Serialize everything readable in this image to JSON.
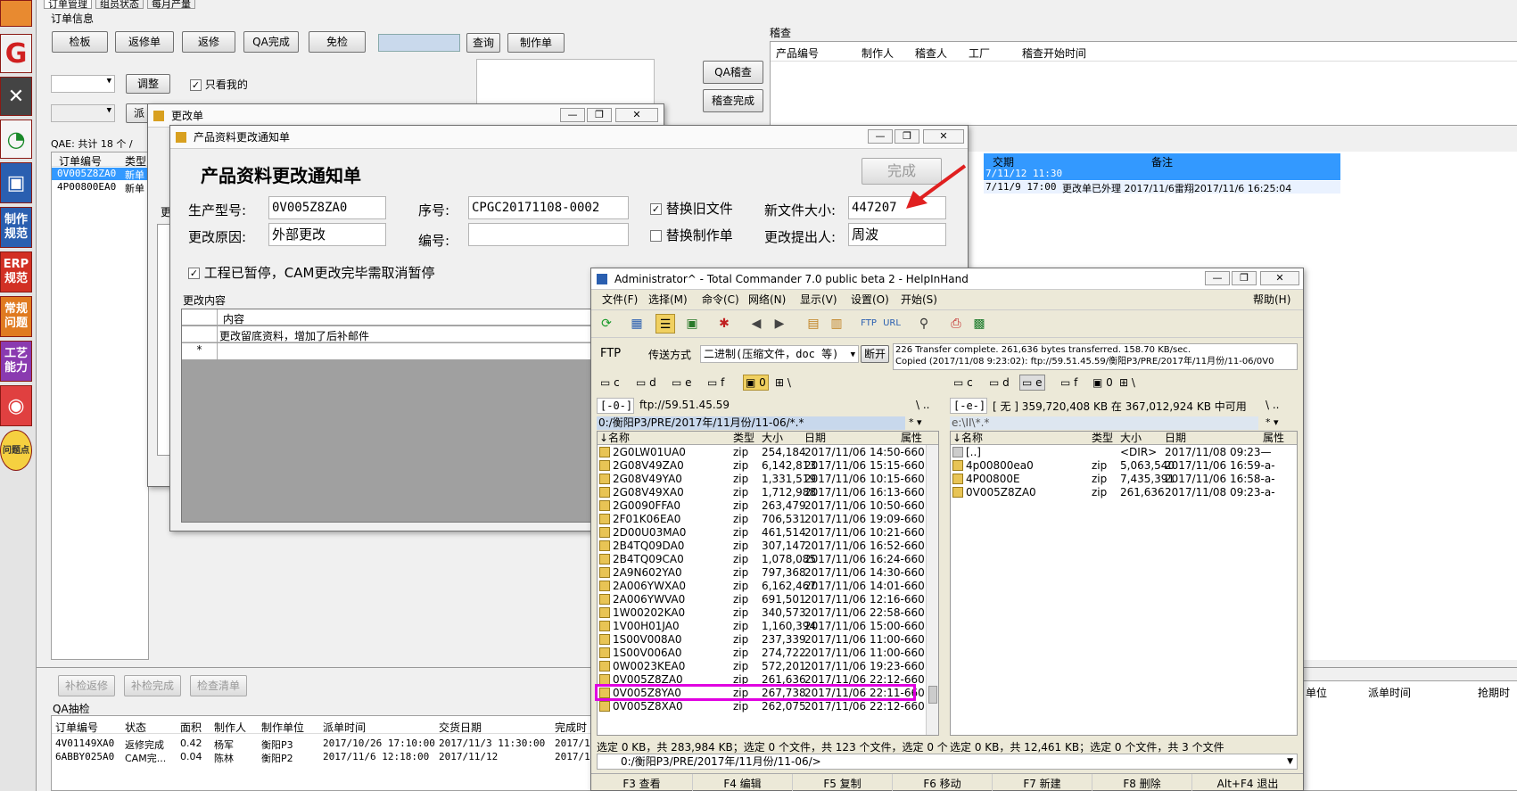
{
  "tabs": [
    "订单管理",
    "组员状态",
    "每月产量"
  ],
  "order_info_label": "订单信息",
  "top_buttons": [
    "检板",
    "返修单",
    "返修",
    "QA完成",
    "免检"
  ],
  "query_btn": "查询",
  "make_order_btn": "制作单",
  "adjust_btn": "调整",
  "only_mine_label": "只看我的",
  "dispatch_btn": "派",
  "qa_audit_btn": "QA稽查",
  "audit_done_btn": "稽查完成",
  "audit_label": "稽查",
  "audit_headers": [
    "产品编号",
    "制作人",
    "稽查人",
    "工厂",
    "稽查开始时间"
  ],
  "qae_count": "QAE: 共计 18 个 /",
  "order_headers": [
    "订单编号",
    "类型"
  ],
  "order_rows": [
    [
      "0V005Z8ZA0",
      "新单"
    ],
    [
      "4P00800EA0",
      "新单"
    ]
  ],
  "right_grid_headers": [
    "交期",
    "备注"
  ],
  "right_grid_rows": [
    [
      "7/11/12 11:30",
      ""
    ],
    [
      "7/11/9 17:00",
      "更改单已外理 2017/11/6雷翔2017/11/6 16:25:04"
    ]
  ],
  "bottom_buttons": [
    "补检返修",
    "补检完成",
    "检查清单"
  ],
  "qa_sample_label": "QA抽检",
  "qa_headers": [
    "订单编号",
    "状态",
    "面积",
    "制作人",
    "制作单位",
    "派单时间",
    "交货日期",
    "完成时"
  ],
  "qa_rows": [
    [
      "4V01149XA0",
      "返修完成",
      "0.42",
      "杨军",
      "衡阳P3",
      "2017/10/26 17:10:00",
      "2017/11/3 11:30:00",
      "2017/1"
    ],
    [
      "6ABBY025A0",
      "CAM完...",
      "0.04",
      "陈林",
      "衡阳P2",
      "2017/11/6 12:18:00",
      "2017/11/12",
      "2017/1"
    ]
  ],
  "right_bottom_headers": [
    "单位",
    "派单时间",
    "",
    "抢期时"
  ],
  "sidebar_tiles": [
    "制作\n规范",
    "ERP\n规范",
    "常规\n问题",
    "工艺\n能力",
    "问题点"
  ],
  "change_win": {
    "title": "更改单",
    "label": "更"
  },
  "notice": {
    "title": "产品资料更改通知单",
    "heading": "产品资料更改通知单",
    "done_btn": "完成",
    "model_label": "生产型号:",
    "model_value": "0V005Z8ZA0",
    "serial_label": "序号:",
    "serial_value": "CPGC20171108-0002",
    "replace_old_label": "替换旧文件",
    "new_size_label": "新文件大小:",
    "new_size_value": "447207",
    "reason_label": "更改原因:",
    "reason_value": "外部更改",
    "code_label": "编号:",
    "code_value": "",
    "replace_make_label": "替换制作单",
    "proposer_label": "更改提出人:",
    "proposer_value": "周波",
    "paused_label": "工程已暂停，CAM更改完毕需取消暂停",
    "content_label": "更改内容",
    "content_header": "内容",
    "content_row": "更改留底资料，增加了后补邮件"
  },
  "tc": {
    "title": "Administrator^ - Total Commander 7.0 public beta 2 - HelpInHand",
    "menu": [
      "文件(F)",
      "选择(M)",
      "命令(C)",
      "网络(N)",
      "显示(V)",
      "设置(O)",
      "开始(S)"
    ],
    "help": "帮助(H)",
    "ftp_label": "FTP",
    "transfer_label": "传送方式",
    "transfer_value": "二进制(压缩文件，doc 等)",
    "disconnect_btn": "断开",
    "log_line1": "226 Transfer complete. 261,636 bytes transferred. 158.70 KB/sec.",
    "log_line2": "Copied (2017/11/08 9:23:02): ftp://59.51.45.59/衡阳P3/PRE/2017年/11月份/11-06/0V0",
    "left_drives": [
      "c",
      "d",
      "e",
      "f",
      "0"
    ],
    "right_drives": [
      "c",
      "d",
      "e",
      "f",
      "0"
    ],
    "left_drive_sel": "[-0-]",
    "left_path_top": "ftp://59.51.45.59",
    "left_path": "0:/衡阳P3/PRE/2017年/11月份/11-06/*.*",
    "right_drive_sel": "[-e-]",
    "right_free": "[ 无 ]  359,720,408 KB 在 367,012,924 KB 中可用",
    "right_path": "e:\\II\\*.*",
    "col_headers": [
      "↓名称",
      "类型",
      "大小",
      "日期",
      "属性"
    ],
    "left_files": [
      [
        "2G0LW01UA0",
        "zip",
        "254,184",
        "2017/11/06 14:50-660"
      ],
      [
        "2G08V49ZA0",
        "zip",
        "6,142,813",
        "2017/11/06 15:15-660"
      ],
      [
        "2G08V49YA0",
        "zip",
        "1,331,519",
        "2017/11/06 10:15-660"
      ],
      [
        "2G08V49XA0",
        "zip",
        "1,712,988",
        "2017/11/06 16:13-660"
      ],
      [
        "2G0090FFA0",
        "zip",
        "263,479",
        "2017/11/06 10:50-660"
      ],
      [
        "2F01K06EA0",
        "zip",
        "706,531",
        "2017/11/06 19:09-660"
      ],
      [
        "2D00U03MA0",
        "zip",
        "461,514",
        "2017/11/06 10:21-660"
      ],
      [
        "2B4TQ09DA0",
        "zip",
        "307,147",
        "2017/11/06 16:52-660"
      ],
      [
        "2B4TQ09CA0",
        "zip",
        "1,078,085",
        "2017/11/06 16:24-660"
      ],
      [
        "2A9N602YA0",
        "zip",
        "797,368",
        "2017/11/06 14:30-660"
      ],
      [
        "2A006YWXA0",
        "zip",
        "6,162,467",
        "2017/11/06 14:01-660"
      ],
      [
        "2A006YWVA0",
        "zip",
        "691,501",
        "2017/11/06 12:16-660"
      ],
      [
        "1W00202KA0",
        "zip",
        "340,573",
        "2017/11/06 22:58-660"
      ],
      [
        "1V00H01JA0",
        "zip",
        "1,160,394",
        "2017/11/06 15:00-660"
      ],
      [
        "1S00V008A0",
        "zip",
        "237,339",
        "2017/11/06 11:00-660"
      ],
      [
        "1S00V006A0",
        "zip",
        "274,722",
        "2017/11/06 11:00-660"
      ],
      [
        "0W0023KEA0",
        "zip",
        "572,201",
        "2017/11/06 19:23-660"
      ],
      [
        "0V005Z8ZA0",
        "zip",
        "261,636",
        "2017/11/06 22:12-660"
      ],
      [
        "0V005Z8YA0",
        "zip",
        "267,738",
        "2017/11/06 22:11-660"
      ],
      [
        "0V005Z8XA0",
        "zip",
        "262,075",
        "2017/11/06 22:12-660"
      ]
    ],
    "right_files": [
      [
        "[..]",
        "",
        "<DIR>",
        "2017/11/08 09:23—"
      ],
      [
        "4p00800ea0",
        "zip",
        "5,063,540",
        "2017/11/06 16:59-a-"
      ],
      [
        "4P00800E",
        "zip",
        "7,435,391",
        "2017/11/06 16:58-a-"
      ],
      [
        "0V005Z8ZA0",
        "zip",
        "261,636",
        "2017/11/08 09:23-a-"
      ]
    ],
    "left_status": "选定 0 KB，共 283,984 KB；选定 0 个文件，共 123 个文件，选定 0 个",
    "right_status": "选定 0 KB，共 12,461 KB；选定 0 个文件，共 3 个文件",
    "cmd_path": "0:/衡阳P3/PRE/2017年/11月份/11-06/>",
    "fkeys": [
      "F3 查看",
      "F4 编辑",
      "F5 复制",
      "F6 移动",
      "F7 新建",
      "F8 删除",
      "Alt+F4 退出"
    ]
  },
  "colors": {
    "highlight": "#e000e0",
    "arrow": "#e02020",
    "selection": "#3399ff",
    "panel_header": "#c8d8ec"
  }
}
